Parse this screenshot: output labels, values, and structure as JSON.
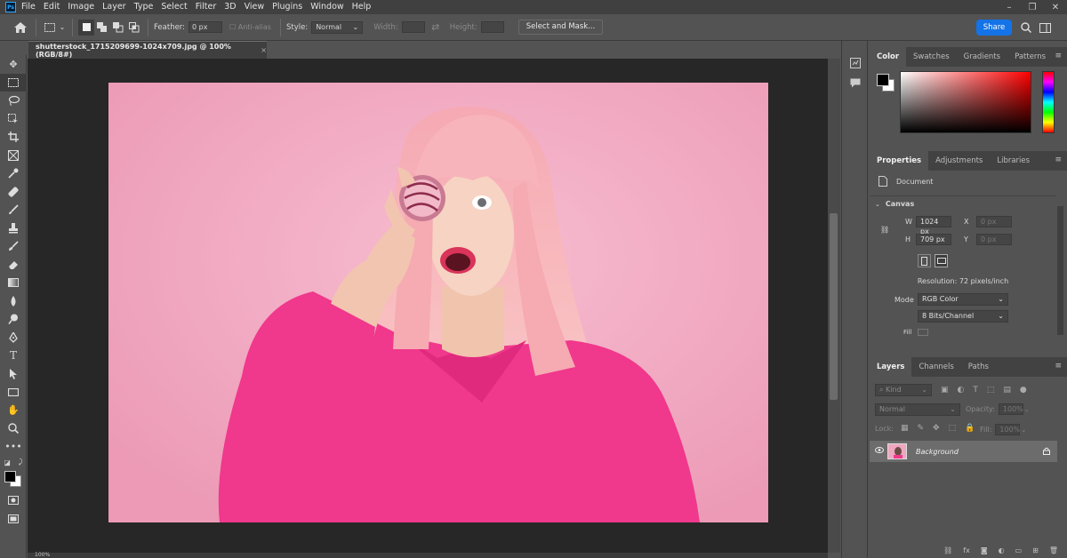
{
  "menu": {
    "logo": "Ps",
    "items": [
      "File",
      "Edit",
      "Image",
      "Layer",
      "Type",
      "Select",
      "Filter",
      "3D",
      "View",
      "Plugins",
      "Window",
      "Help"
    ]
  },
  "window_controls": {
    "minimize": "–",
    "restore": "❐",
    "close": "✕"
  },
  "options_bar": {
    "feather_label": "Feather:",
    "feather_value": "0 px",
    "anti_alias_label": "Anti-alias",
    "style_label": "Style:",
    "style_value": "Normal",
    "width_label": "Width:",
    "height_label": "Height:",
    "select_mask_label": "Select and Mask...",
    "share_label": "Share"
  },
  "document": {
    "tab_title": "shutterstock_1715209699-1024x709.jpg @ 100% (RGB/8#)",
    "close": "×"
  },
  "status": {
    "zoom": "100%"
  },
  "color_panel": {
    "tabs": [
      "Color",
      "Swatches",
      "Gradients",
      "Patterns"
    ],
    "foreground": "#000000",
    "background": "#ffffff"
  },
  "properties_panel": {
    "tabs": [
      "Properties",
      "Adjustments",
      "Libraries"
    ],
    "document_label": "Document",
    "canvas_label": "Canvas",
    "w_label": "W",
    "w_value": "1024 px",
    "h_label": "H",
    "h_value": "709 px",
    "x_label": "X",
    "x_value": "0 px",
    "y_label": "Y",
    "y_value": "0 px",
    "resolution": "Resolution: 72 pixels/inch",
    "mode_label": "Mode",
    "mode_value": "RGB Color",
    "bits_value": "8 Bits/Channel",
    "fill_label": "Fill"
  },
  "layers_panel": {
    "tabs": [
      "Layers",
      "Channels",
      "Paths"
    ],
    "kind_label": "Kind",
    "blend_mode": "Normal",
    "opacity_label": "Opacity:",
    "opacity_value": "100%",
    "lock_label": "Lock:",
    "fill_label": "Fill:",
    "fill_value": "100%",
    "layer_name": "Background"
  },
  "colors": {
    "accent": "#1473e6",
    "canvas_bg": "#f0a7c0",
    "shirt": "#f0388c",
    "hair": "#f7b3b8"
  }
}
